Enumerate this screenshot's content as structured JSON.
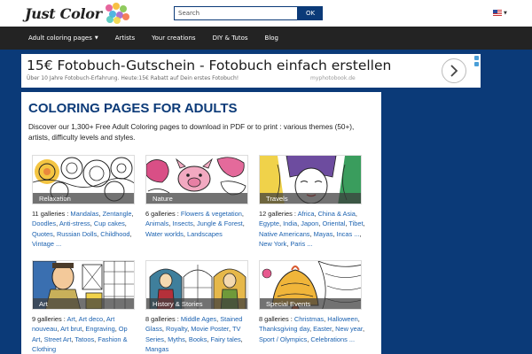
{
  "header": {
    "logo_text": "Just Color",
    "search_placeholder": "Search",
    "search_button": "OK",
    "language_icon": "us-flag-icon"
  },
  "nav": {
    "items": [
      {
        "label": "Adult coloring pages",
        "has_dropdown": true
      },
      {
        "label": "Artists"
      },
      {
        "label": "Your creations"
      },
      {
        "label": "DIY & Tutos"
      },
      {
        "label": "Blog"
      }
    ]
  },
  "ad": {
    "title": "15€ Fotobuch-Gutschein - Fotobuch einfach erstellen",
    "subtitle": "Über 10 Jahre Fotobuch-Erfahrung. Heute:15€ Rabatt auf Dein erstes Fotobuch!",
    "domain": "myphotobook.de",
    "arrow_icon": "chevron-right-icon"
  },
  "page": {
    "title": "COLORING PAGES FOR ADULTS",
    "intro": "Discover our 1,300+ Free Adult Coloring pages to download in PDF or to print : various themes (50+), artists, difficulty levels and styles."
  },
  "categories": [
    {
      "name": "Relaxation",
      "count": "11 galleries : ",
      "links": [
        "Mandalas",
        "Zentangle",
        "Doodles",
        "Anti-stress",
        "Cup cakes",
        "Quotes",
        "Russian Dolls",
        "Childhood",
        "Vintage ..."
      ]
    },
    {
      "name": "Nature",
      "count": "6 galleries : ",
      "links": [
        "Flowers & vegetation",
        "Animals",
        "Insects",
        "Jungle & Forest",
        "Water worlds",
        "Landscapes"
      ]
    },
    {
      "name": "Travels",
      "count": "12 galleries : ",
      "links": [
        "Africa",
        "China & Asia",
        "Egypte",
        "India",
        "Japon",
        "Oriental",
        "Tibet",
        "Native Americans",
        "Mayas",
        "Incas ...",
        "New York",
        "Paris ..."
      ]
    },
    {
      "name": "Art",
      "count": "9 galleries : ",
      "links": [
        "Art",
        "Art deco",
        "Art nouveau",
        "Art brut",
        "Engraving",
        "Op Art",
        "Street Art",
        "Tatoos",
        "Fashion & Clothing"
      ]
    },
    {
      "name": "History & Stories",
      "count": "8 galleries : ",
      "links": [
        "Middle Ages",
        "Stained Glass",
        "Royalty",
        "Movie Poster",
        "TV Series",
        "Myths",
        "Books",
        "Fairy tales",
        "Mangas"
      ]
    },
    {
      "name": "Special Events",
      "count": "8 galleries : ",
      "links": [
        "Christmas",
        "Halloween",
        "Thanksgiving day",
        "Easter",
        "New year",
        "Sport / Olympics",
        "Celebrations ..."
      ]
    }
  ],
  "colors": {
    "background": "#0b3a78",
    "nav_bg": "#232323",
    "title_blue": "#0b3a78",
    "link_blue": "#1c62b0"
  }
}
